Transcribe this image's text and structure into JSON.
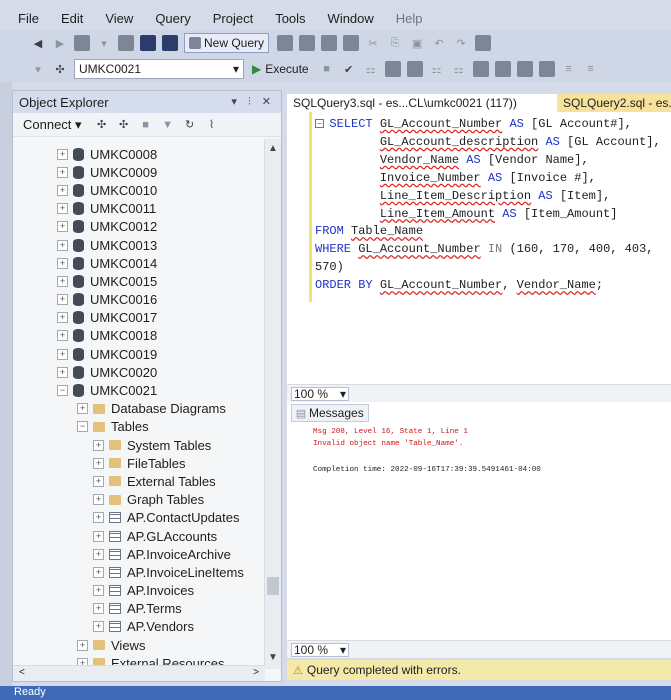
{
  "menu": [
    "File",
    "Edit",
    "View",
    "Query",
    "Project",
    "Tools",
    "Window",
    "Help"
  ],
  "toolbar": {
    "new_query_label": "New Query",
    "database": "UMKC0021",
    "execute_label": "Execute"
  },
  "object_explorer": {
    "title": "Object Explorer",
    "pin_controls": "▾ ⫶ ✕",
    "connect_label": "Connect ▾",
    "databases": [
      "UMKC0008",
      "UMKC0009",
      "UMKC0010",
      "UMKC0011",
      "UMKC0012",
      "UMKC0013",
      "UMKC0014",
      "UMKC0015",
      "UMKC0016",
      "UMKC0017",
      "UMKC0018",
      "UMKC0019",
      "UMKC0020"
    ],
    "expanded_db": "UMKC0021",
    "db_children": [
      "Database Diagrams",
      "Tables"
    ],
    "table_folders": [
      "System Tables",
      "FileTables",
      "External Tables",
      "Graph Tables"
    ],
    "tables": [
      "AP.ContactUpdates",
      "AP.GLAccounts",
      "AP.InvoiceArchive",
      "AP.InvoiceLineItems",
      "AP.Invoices",
      "AP.Terms",
      "AP.Vendors"
    ],
    "after_tables": [
      "Views",
      "External Resources"
    ]
  },
  "editor": {
    "active_tab": "SQLQuery3.sql - es...CL\\umkc0021 (117))",
    "other_tab": "SQLQuery2.sql - es...",
    "zoom": "100 %"
  },
  "results": {
    "messages_tab": "Messages",
    "error_line1": "Msg 208, Level 16, State 1, Line 1",
    "error_line2": "Invalid object name 'Table_Name'.",
    "completion": "Completion time: 2022-09-16T17:39:39.5491461-04:00",
    "zoom": "100 %",
    "status": "Query completed with errors."
  },
  "statusbar": {
    "text": "Ready"
  }
}
